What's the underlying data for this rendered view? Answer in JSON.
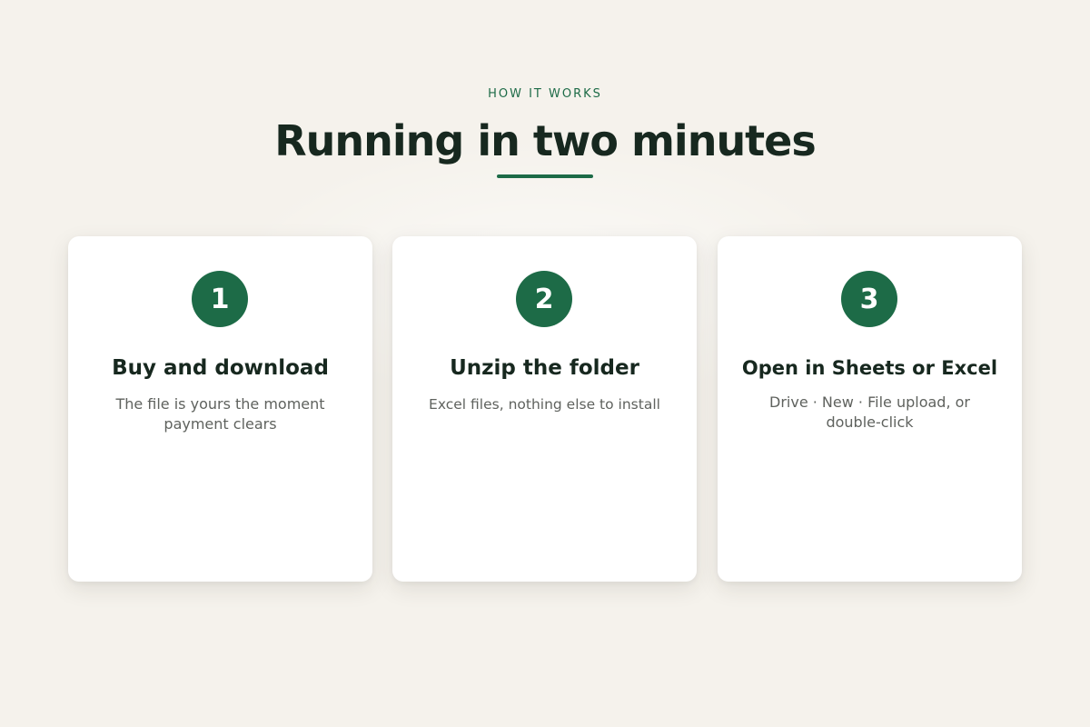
{
  "section": {
    "eyebrow": "HOW IT WORKS",
    "title": "Running in two minutes"
  },
  "steps": [
    {
      "number": "1",
      "title": "Buy and download",
      "description": "The file is yours the moment payment clears"
    },
    {
      "number": "2",
      "title": "Unzip the folder",
      "description": "Excel files, nothing else to install"
    },
    {
      "number": "3",
      "title": "Open in Sheets or Excel",
      "description": "Drive · New · File upload, or double-click"
    }
  ],
  "colors": {
    "background": "#f5f2ec",
    "accent": "#1d6b47",
    "heading": "#17281f",
    "body_text": "#5f625e",
    "card": "#ffffff"
  }
}
